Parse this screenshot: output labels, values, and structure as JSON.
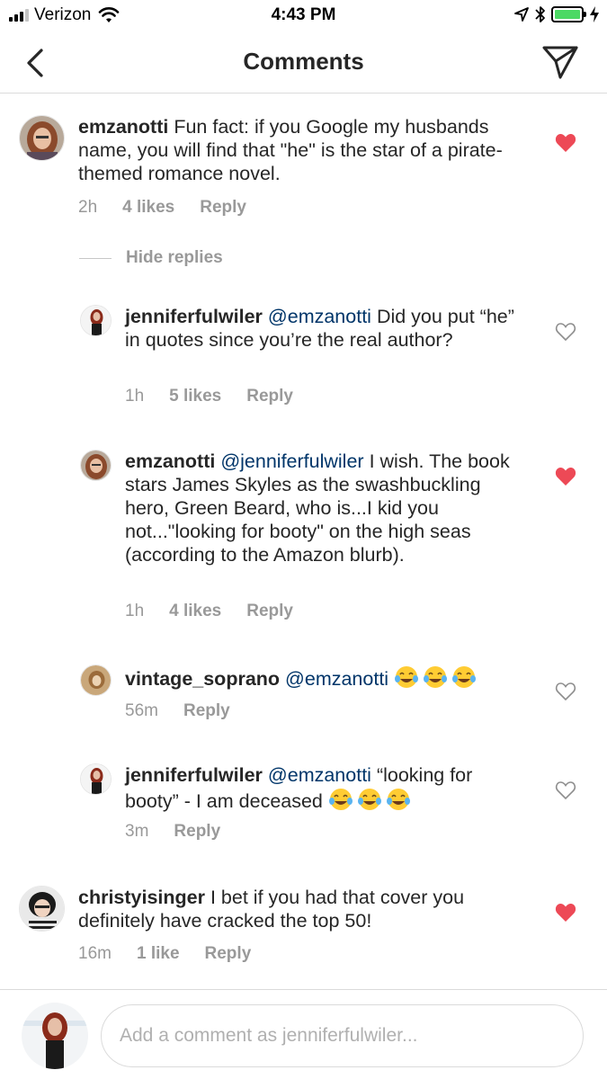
{
  "status_bar": {
    "carrier": "Verizon",
    "time": "4:43 PM",
    "battery_color": "#4cd964"
  },
  "nav": {
    "title": "Comments",
    "back_icon": "chevron-left-icon",
    "send_icon": "paper-plane-icon"
  },
  "colors": {
    "liked_heart": "#ed4956",
    "mention": "#003569",
    "meta_gray": "#999999"
  },
  "comments": [
    {
      "username": "emzanotti",
      "text": "Fun fact: if you Google my husbands name, you will find that \"he\" is the star of a pirate-themed romance novel.",
      "time": "2h",
      "likes": "4 likes",
      "reply": "Reply",
      "liked": true
    },
    {
      "username": "christyisinger",
      "text": "I bet if you had that cover you definitely have cracked the top 50!",
      "time": "16m",
      "likes": "1 like",
      "reply": "Reply",
      "liked": true
    }
  ],
  "hide_replies": "Hide replies",
  "replies": [
    {
      "username": "jenniferfulwiler",
      "mention": "@emzanotti",
      "text": "Did you put “he” in quotes since you’re the real author?",
      "time": "1h",
      "likes": "5 likes",
      "reply": "Reply",
      "liked": false
    },
    {
      "username": "emzanotti",
      "mention": "@jenniferfulwiler",
      "text": "I wish. The book stars James Skyles as the swashbuckling hero, Green Beard, who is...I kid you not...\"looking for booty\" on the high seas (according to the Amazon blurb).",
      "time": "1h",
      "likes": "4 likes",
      "reply": "Reply",
      "liked": true
    },
    {
      "username": "vintage_soprano",
      "mention": "@emzanotti",
      "text": "",
      "emoji": "tears-of-joy-emoji",
      "time": "56m",
      "reply": "Reply",
      "liked": false
    },
    {
      "username": "jenniferfulwiler",
      "mention": "@emzanotti",
      "text": "“looking for booty” - I am deceased",
      "emoji": "tears-of-joy-emoji",
      "time": "3m",
      "reply": "Reply",
      "liked": false
    }
  ],
  "input": {
    "placeholder": "Add a comment as jenniferfulwiler..."
  }
}
